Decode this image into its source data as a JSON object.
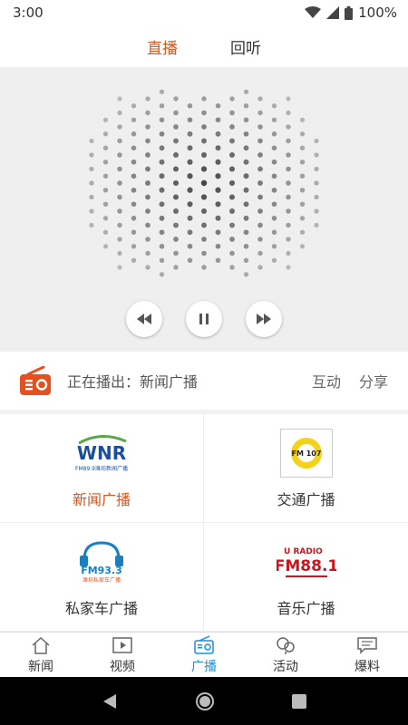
{
  "status_bar": {
    "time": "3:00",
    "battery": "100%"
  },
  "top_tabs": [
    {
      "label": "直播",
      "active": true
    },
    {
      "label": "回听",
      "active": false
    }
  ],
  "player": {
    "controls": [
      "rewind-icon",
      "pause-icon",
      "fast-forward-icon"
    ]
  },
  "now_playing": {
    "text": "正在播出：新闻广播",
    "interact_label": "互动",
    "share_label": "分享",
    "icon": "radio-icon",
    "accent": "#e5501e"
  },
  "stations": [
    {
      "label": "新闻广播",
      "active": true,
      "logo_text": "WNR",
      "logo_sub": "FM89.9潍坊新闻广播"
    },
    {
      "label": "交通广播",
      "active": false,
      "logo_text": "FM 107"
    },
    {
      "label": "私家车广播",
      "active": false,
      "logo_text": "FM93.3",
      "logo_sub": "潍坊私家车广播"
    },
    {
      "label": "音乐广播",
      "active": false,
      "logo_text": "FM88.1",
      "logo_sub": "U RADIO"
    }
  ],
  "bottom_nav": [
    {
      "label": "新闻",
      "icon": "home-icon",
      "active": false
    },
    {
      "label": "视频",
      "icon": "video-icon",
      "active": false
    },
    {
      "label": "广播",
      "icon": "radio-icon",
      "active": true
    },
    {
      "label": "活动",
      "icon": "activity-icon",
      "active": false
    },
    {
      "label": "爆料",
      "icon": "message-icon",
      "active": false
    }
  ],
  "colors": {
    "accent_orange": "#e0531c",
    "accent_blue": "#1f8ed8"
  }
}
